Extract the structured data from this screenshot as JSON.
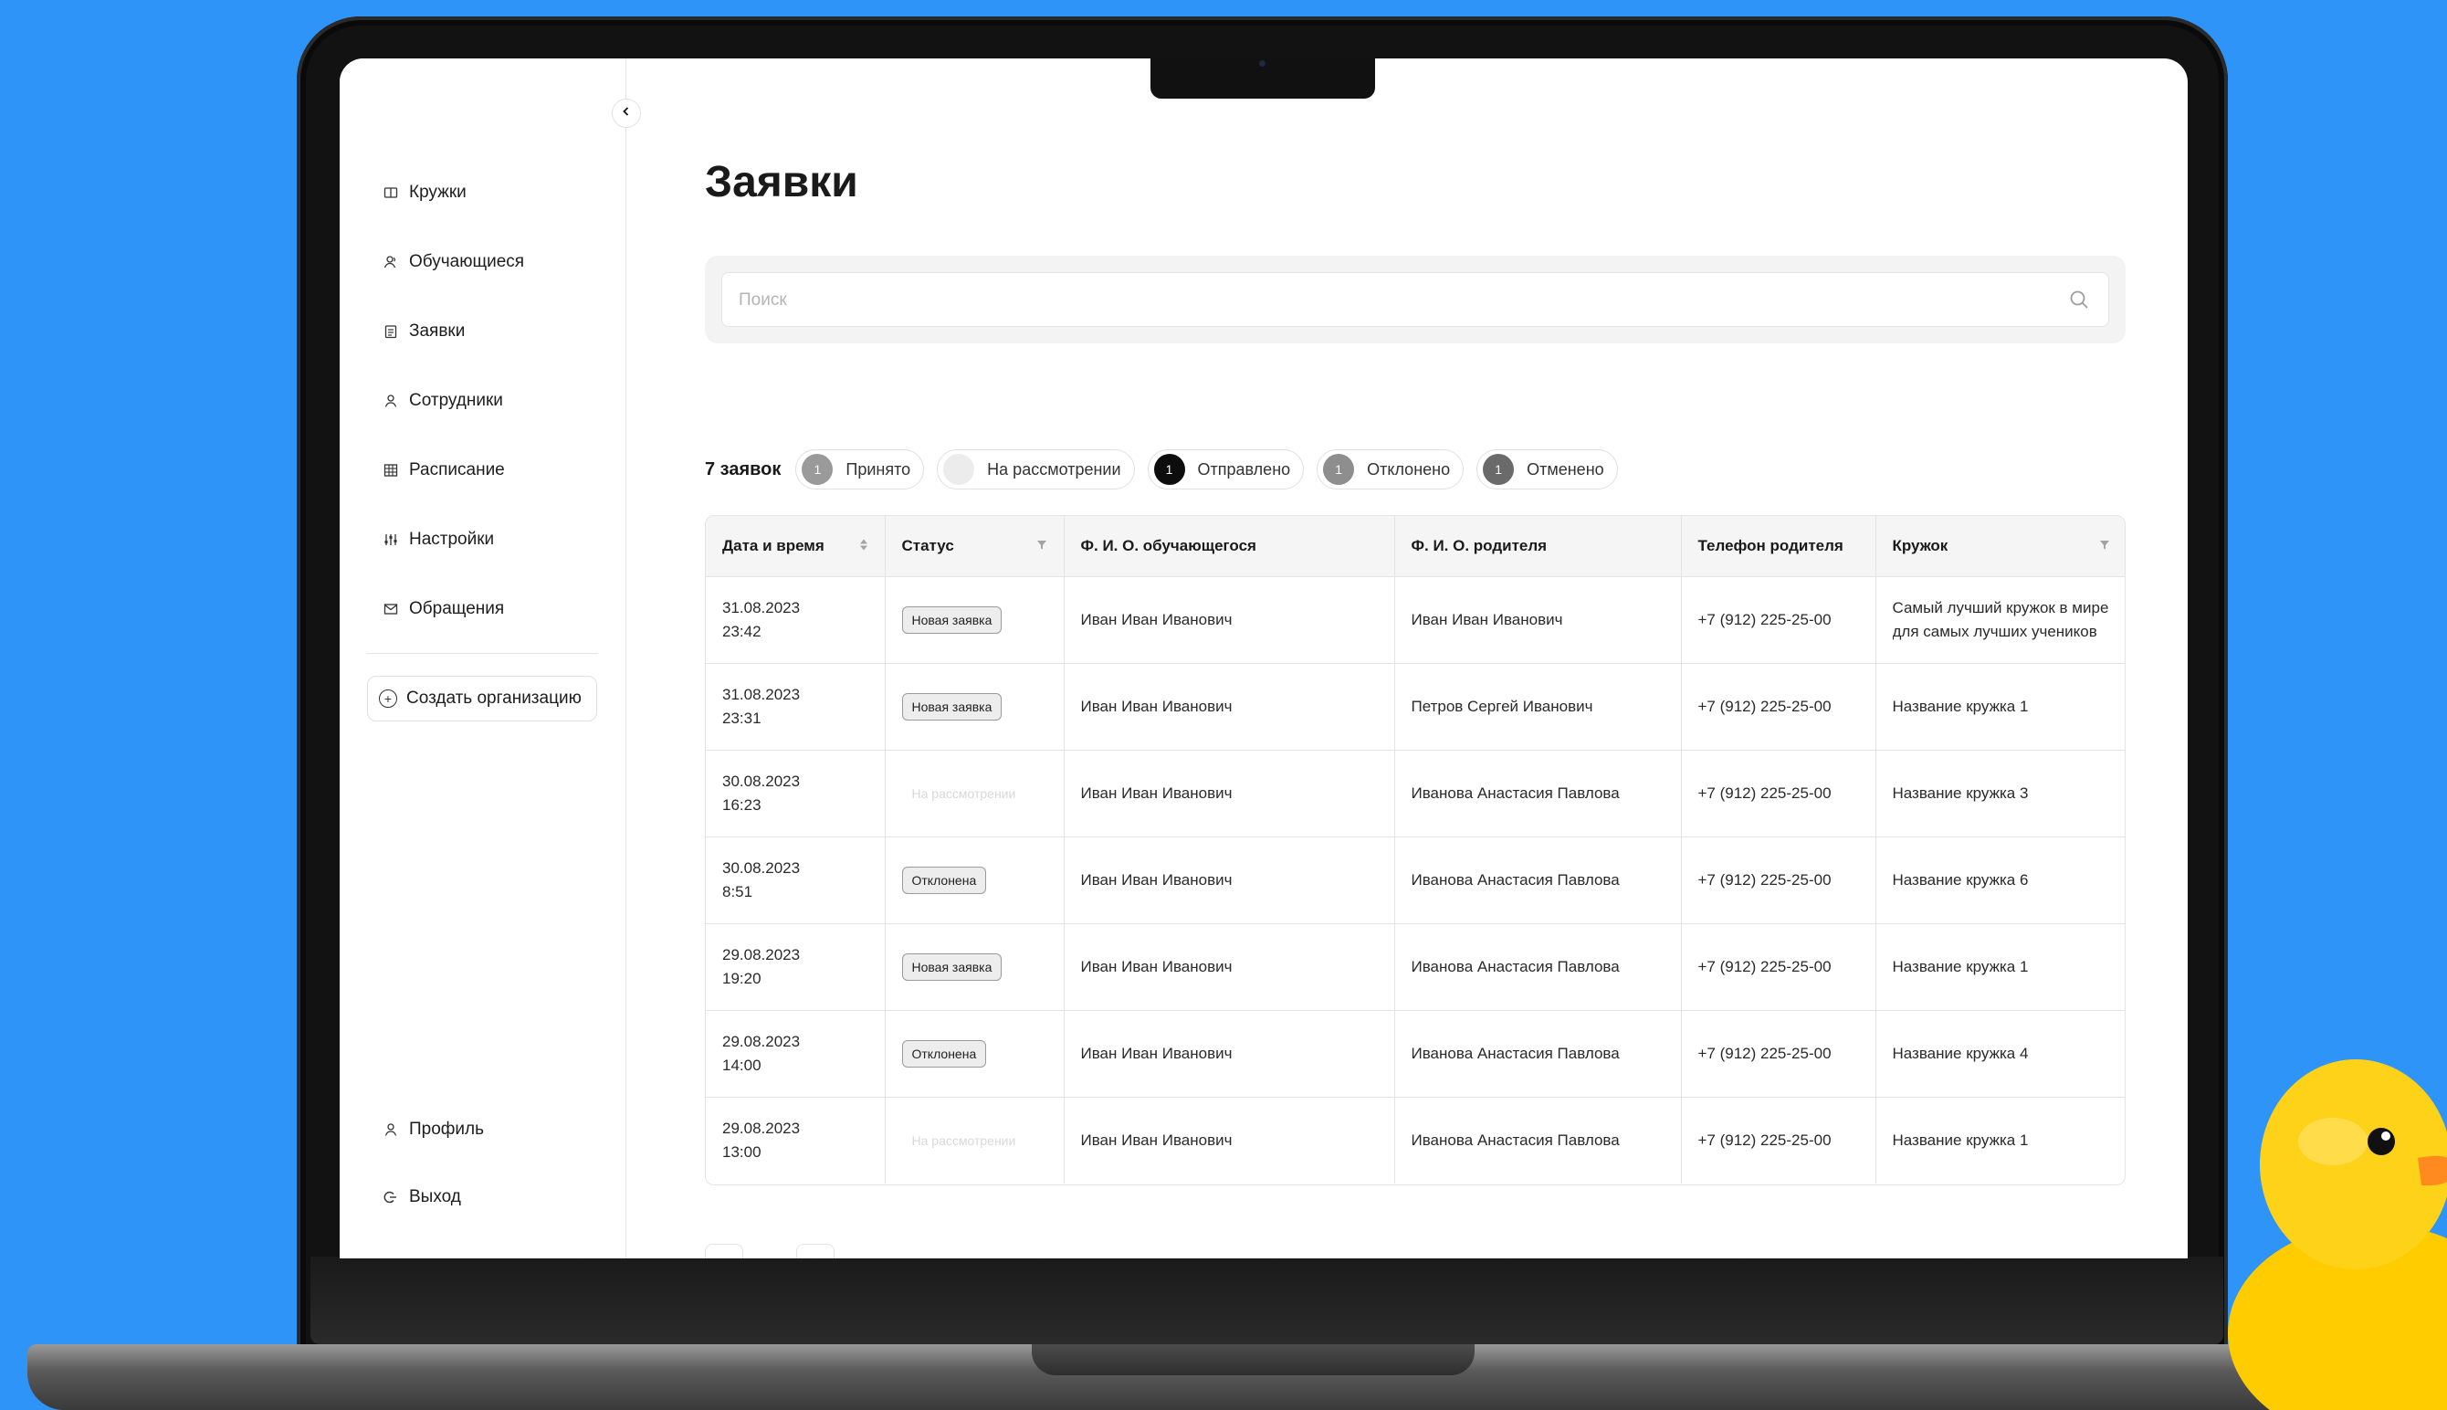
{
  "sidebar": {
    "items": [
      {
        "label": "Кружки",
        "icon": "book-icon"
      },
      {
        "label": "Обучающиеся",
        "icon": "students-icon"
      },
      {
        "label": "Заявки",
        "icon": "clipboard-icon"
      },
      {
        "label": "Сотрудники",
        "icon": "user-icon"
      },
      {
        "label": "Расписание",
        "icon": "calendar-grid-icon"
      },
      {
        "label": "Настройки",
        "icon": "sliders-icon"
      },
      {
        "label": "Обращения",
        "icon": "mail-icon"
      }
    ],
    "create_org_label": "Создать организацию",
    "bottom": [
      {
        "label": "Профиль",
        "icon": "user-icon"
      },
      {
        "label": "Выход",
        "icon": "logout-icon"
      }
    ]
  },
  "page": {
    "title": "Заявки",
    "search_placeholder": "Поиск"
  },
  "filters": {
    "count_label": "7 заявок",
    "chips": [
      {
        "count": "1",
        "label": "Принято",
        "color": "#9a9a9a"
      },
      {
        "count": "",
        "label": "На рассмотрении",
        "color": "#ececec"
      },
      {
        "count": "1",
        "label": "Отправлено",
        "color": "#0d0d0d"
      },
      {
        "count": "1",
        "label": "Отклонено",
        "color": "#8e8e8e"
      },
      {
        "count": "1",
        "label": "Отменено",
        "color": "#6a6a6a"
      }
    ]
  },
  "table": {
    "columns": [
      "Дата и время",
      "Статус",
      "Ф. И. О. обучающегося",
      "Ф. И. О. родителя",
      "Телефон родителя",
      "Кружок"
    ],
    "rows": [
      {
        "date": "31.08.2023",
        "time": "23:42",
        "status": "Новая заявка",
        "status_style": "badge",
        "student": "Иван Иван Иванович",
        "parent": "Иван Иван Иванович",
        "phone": "+7 (912) 225-25-00",
        "club": "Самый лучший кружок в мире для самых лучших учеников"
      },
      {
        "date": "31.08.2023",
        "time": "23:31",
        "status": "Новая заявка",
        "status_style": "badge",
        "student": "Иван Иван Иванович",
        "parent": "Петров Сергей Иванович",
        "phone": "+7 (912) 225-25-00",
        "club": "Название кружка 1"
      },
      {
        "date": "30.08.2023",
        "time": "16:23",
        "status": "На рассмотрении",
        "status_style": "ghost",
        "student": "Иван Иван Иванович",
        "parent": "Иванова Анастасия Павлова",
        "phone": "+7 (912) 225-25-00",
        "club": "Название кружка 3"
      },
      {
        "date": "30.08.2023",
        "time": "8:51",
        "status": "Отклонена",
        "status_style": "badge",
        "student": "Иван Иван Иванович",
        "parent": "Иванова Анастасия Павлова",
        "phone": "+7 (912) 225-25-00",
        "club": "Название кружка 6"
      },
      {
        "date": "29.08.2023",
        "time": "19:20",
        "status": "Новая заявка",
        "status_style": "badge",
        "student": "Иван Иван Иванович",
        "parent": "Иванова Анастасия Павлова",
        "phone": "+7 (912) 225-25-00",
        "club": "Название кружка 1"
      },
      {
        "date": "29.08.2023",
        "time": "14:00",
        "status": "Отклонена",
        "status_style": "badge",
        "student": "Иван Иван Иванович",
        "parent": "Иванова Анастасия Павлова",
        "phone": "+7 (912) 225-25-00",
        "club": "Название кружка 4"
      },
      {
        "date": "29.08.2023",
        "time": "13:00",
        "status": "На рассмотрении",
        "status_style": "ghost",
        "student": "Иван Иван Иванович",
        "parent": "Иванова Анастасия Павлова",
        "phone": "+7 (912) 225-25-00",
        "club": "Название кружка 1"
      }
    ]
  },
  "pager": {
    "prev_icon": "chevron-left-icon",
    "next_icon": "chevron-right-icon"
  },
  "colors": {
    "background": "#2f94f7",
    "duck": "#ffcc00",
    "beak": "#ff8a1f"
  }
}
